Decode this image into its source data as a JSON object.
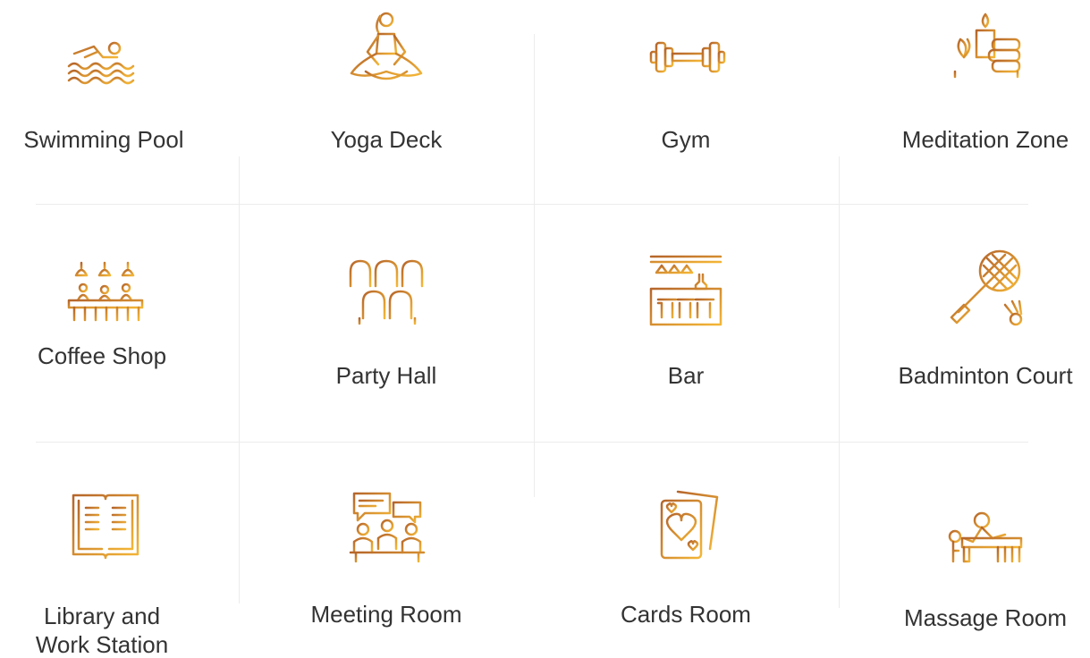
{
  "amenities": [
    {
      "label": "Swimming Pool",
      "icon": "swimmer-icon"
    },
    {
      "label": "Yoga Deck",
      "icon": "yoga-pose-icon"
    },
    {
      "label": "Gym",
      "icon": "dumbbell-icon"
    },
    {
      "label": "Meditation Zone",
      "icon": "candle-stones-icon"
    },
    {
      "label": "Coffee Shop",
      "icon": "coffee-counter-icon"
    },
    {
      "label": "Party Hall",
      "icon": "chairs-icon"
    },
    {
      "label": "Bar",
      "icon": "bar-counter-icon"
    },
    {
      "label": "Badminton Court",
      "icon": "racket-shuttlecock-icon"
    },
    {
      "label_line1": "Library and",
      "label_line2": "Work Station",
      "icon": "open-book-icon"
    },
    {
      "label": "Meeting Room",
      "icon": "meeting-icon"
    },
    {
      "label": "Cards Room",
      "icon": "playing-cards-icon"
    },
    {
      "label": "Massage Room",
      "icon": "massage-icon"
    }
  ],
  "colors": {
    "icon_brown": "#b5652b",
    "icon_gold": "#f4b636",
    "text": "#333333",
    "divider": "#ececec"
  }
}
